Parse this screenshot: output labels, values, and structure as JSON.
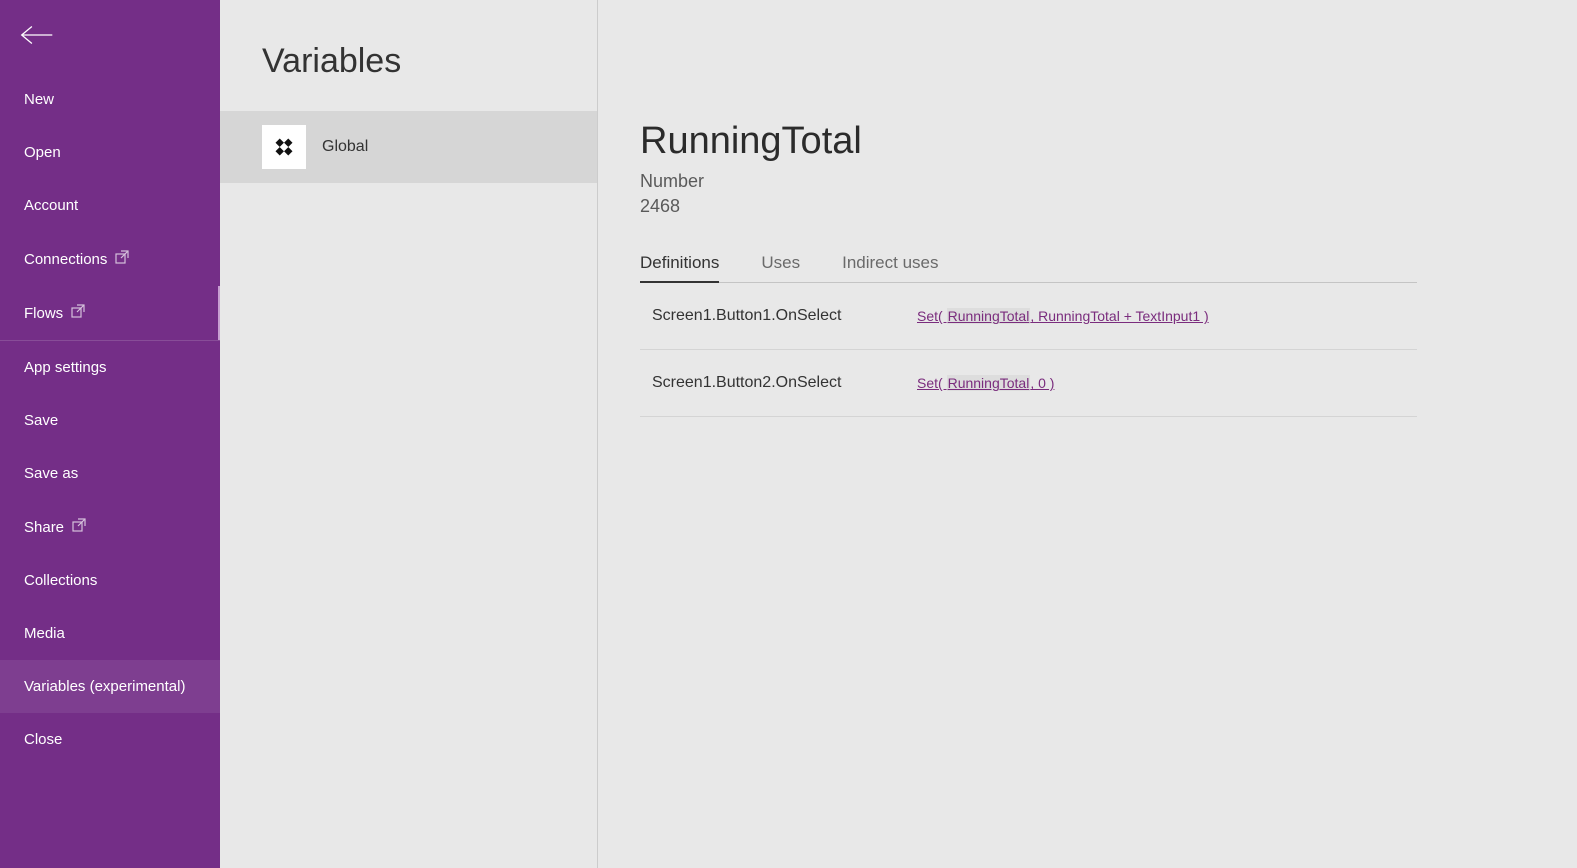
{
  "sidebar": {
    "items": [
      {
        "label": "New",
        "external": false,
        "active": false
      },
      {
        "label": "Open",
        "external": false,
        "active": false
      },
      {
        "label": "Account",
        "external": false,
        "active": false
      },
      {
        "label": "Connections",
        "external": true,
        "active": false
      },
      {
        "label": "Flows",
        "external": true,
        "active": false
      },
      {
        "label": "App settings",
        "external": false,
        "active": false
      },
      {
        "label": "Save",
        "external": false,
        "active": false
      },
      {
        "label": "Save as",
        "external": false,
        "active": false
      },
      {
        "label": "Share",
        "external": true,
        "active": false
      },
      {
        "label": "Collections",
        "external": false,
        "active": false
      },
      {
        "label": "Media",
        "external": false,
        "active": false
      },
      {
        "label": "Variables (experimental)",
        "external": false,
        "active": true
      },
      {
        "label": "Close",
        "external": false,
        "active": false
      }
    ]
  },
  "middle": {
    "title": "Variables",
    "scope": {
      "label": "Global",
      "selected": true
    }
  },
  "main": {
    "variable": {
      "name": "RunningTotal",
      "type": "Number",
      "value": "2468"
    },
    "tabs": [
      {
        "label": "Definitions",
        "active": true
      },
      {
        "label": "Uses",
        "active": false
      },
      {
        "label": "Indirect uses",
        "active": false
      }
    ],
    "definitions": [
      {
        "path": "Screen1.Button1.OnSelect",
        "formula_prefix": "Set( ",
        "formula_hl": "RunningTotal",
        "formula_suffix": ", RunningTotal + TextInput1 )"
      },
      {
        "path": "Screen1.Button2.OnSelect",
        "formula_prefix": "Set( ",
        "formula_hl": "RunningTotal",
        "formula_suffix": ", 0 )"
      }
    ]
  }
}
